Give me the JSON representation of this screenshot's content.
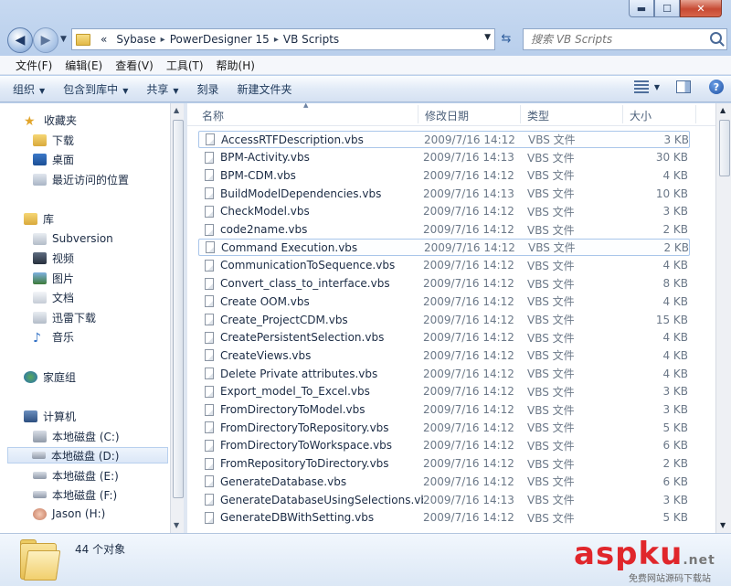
{
  "window": {
    "caption_buttons": {
      "minimize": "▬",
      "maximize": "☐",
      "close": "✕"
    }
  },
  "address": {
    "overflow": "«",
    "crumbs": [
      "Sybase",
      "PowerDesigner 15",
      "VB Scripts"
    ],
    "search_placeholder": "搜索 VB Scripts"
  },
  "menu": [
    "文件(F)",
    "编辑(E)",
    "查看(V)",
    "工具(T)",
    "帮助(H)"
  ],
  "toolbar": {
    "organize": "组织",
    "include_library": "包含到库中",
    "share": "共享",
    "burn": "刻录",
    "new_folder": "新建文件夹"
  },
  "nav": {
    "favorites": "收藏夹",
    "favorites_items": [
      "下载",
      "桌面",
      "最近访问的位置"
    ],
    "libraries": "库",
    "library_items": [
      "Subversion",
      "视频",
      "图片",
      "文档",
      "迅雷下载",
      "音乐"
    ],
    "homegroup": "家庭组",
    "computer": "计算机",
    "drives": [
      "本地磁盘 (C:)",
      "本地磁盘 (D:)",
      "本地磁盘 (E:)",
      "本地磁盘 (F:)",
      "Jason (H:)"
    ]
  },
  "columns": {
    "name": "名称",
    "date": "修改日期",
    "type": "类型",
    "size": "大小"
  },
  "files": [
    {
      "name": "AccessRTFDescription.vbs",
      "date": "2009/7/16 14:12",
      "type": "VBS 文件",
      "size": "3 KB"
    },
    {
      "name": "BPM-Activity.vbs",
      "date": "2009/7/16 14:13",
      "type": "VBS 文件",
      "size": "30 KB"
    },
    {
      "name": "BPM-CDM.vbs",
      "date": "2009/7/16 14:12",
      "type": "VBS 文件",
      "size": "4 KB"
    },
    {
      "name": "BuildModelDependencies.vbs",
      "date": "2009/7/16 14:13",
      "type": "VBS 文件",
      "size": "10 KB"
    },
    {
      "name": "CheckModel.vbs",
      "date": "2009/7/16 14:12",
      "type": "VBS 文件",
      "size": "3 KB"
    },
    {
      "name": "code2name.vbs",
      "date": "2009/7/16 14:12",
      "type": "VBS 文件",
      "size": "2 KB"
    },
    {
      "name": "Command Execution.vbs",
      "date": "2009/7/16 14:12",
      "type": "VBS 文件",
      "size": "2 KB"
    },
    {
      "name": "CommunicationToSequence.vbs",
      "date": "2009/7/16 14:12",
      "type": "VBS 文件",
      "size": "4 KB"
    },
    {
      "name": "Convert_class_to_interface.vbs",
      "date": "2009/7/16 14:12",
      "type": "VBS 文件",
      "size": "8 KB"
    },
    {
      "name": "Create OOM.vbs",
      "date": "2009/7/16 14:12",
      "type": "VBS 文件",
      "size": "4 KB"
    },
    {
      "name": "Create_ProjectCDM.vbs",
      "date": "2009/7/16 14:12",
      "type": "VBS 文件",
      "size": "15 KB"
    },
    {
      "name": "CreatePersistentSelection.vbs",
      "date": "2009/7/16 14:12",
      "type": "VBS 文件",
      "size": "4 KB"
    },
    {
      "name": "CreateViews.vbs",
      "date": "2009/7/16 14:12",
      "type": "VBS 文件",
      "size": "4 KB"
    },
    {
      "name": "Delete Private attributes.vbs",
      "date": "2009/7/16 14:12",
      "type": "VBS 文件",
      "size": "4 KB"
    },
    {
      "name": "Export_model_To_Excel.vbs",
      "date": "2009/7/16 14:12",
      "type": "VBS 文件",
      "size": "3 KB"
    },
    {
      "name": "FromDirectoryToModel.vbs",
      "date": "2009/7/16 14:12",
      "type": "VBS 文件",
      "size": "3 KB"
    },
    {
      "name": "FromDirectoryToRepository.vbs",
      "date": "2009/7/16 14:12",
      "type": "VBS 文件",
      "size": "5 KB"
    },
    {
      "name": "FromDirectoryToWorkspace.vbs",
      "date": "2009/7/16 14:12",
      "type": "VBS 文件",
      "size": "6 KB"
    },
    {
      "name": "FromRepositoryToDirectory.vbs",
      "date": "2009/7/16 14:12",
      "type": "VBS 文件",
      "size": "2 KB"
    },
    {
      "name": "GenerateDatabase.vbs",
      "date": "2009/7/16 14:12",
      "type": "VBS 文件",
      "size": "6 KB"
    },
    {
      "name": "GenerateDatabaseUsingSelections.vbs",
      "date": "2009/7/16 14:13",
      "type": "VBS 文件",
      "size": "3 KB"
    },
    {
      "name": "GenerateDBWithSetting.vbs",
      "date": "2009/7/16 14:12",
      "type": "VBS 文件",
      "size": "5 KB"
    }
  ],
  "status": {
    "count": "44 个对象"
  },
  "watermark": {
    "logo": "asp",
    "logo2": "ku",
    "tld": ".net",
    "tagline": "免费网站源码下载站"
  }
}
